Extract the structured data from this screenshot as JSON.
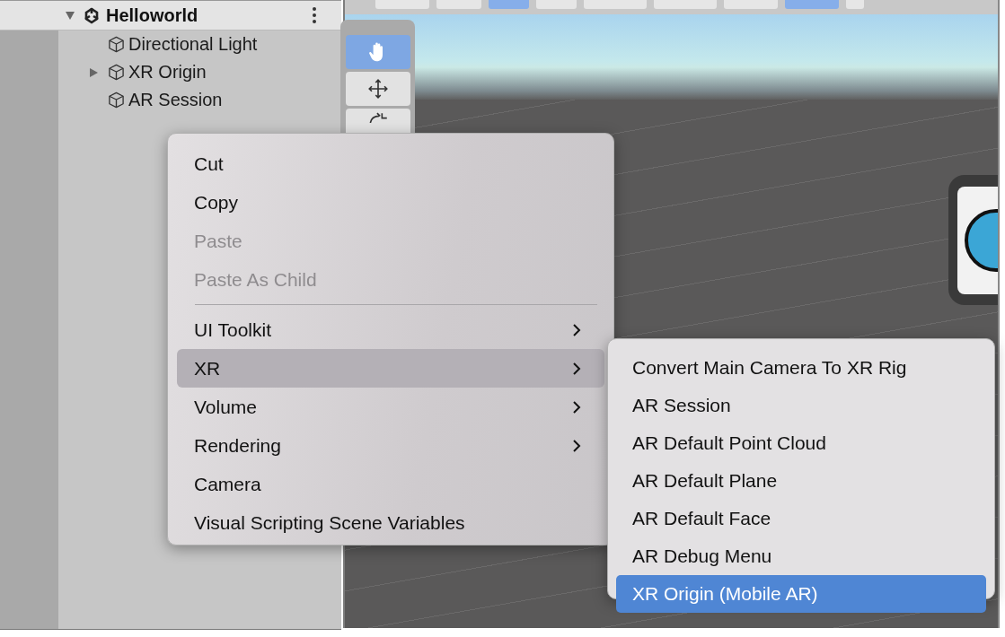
{
  "hierarchy": {
    "scene": {
      "label": "Helloworld",
      "expanded": true,
      "children": [
        {
          "label": "Directional Light"
        },
        {
          "label": "XR Origin",
          "expanded": false
        },
        {
          "label": "AR Session"
        }
      ]
    }
  },
  "scene_tools": [
    {
      "kind": "hand",
      "selected": true
    },
    {
      "kind": "move",
      "selected": false
    },
    {
      "kind": "rotate",
      "selected": false
    }
  ],
  "context_menu": {
    "items": [
      {
        "kind": "item",
        "label": "Cut",
        "disabled": false,
        "has_submenu": false,
        "highlighted": false
      },
      {
        "kind": "item",
        "label": "Copy",
        "disabled": false,
        "has_submenu": false,
        "highlighted": false
      },
      {
        "kind": "item",
        "label": "Paste",
        "disabled": true,
        "has_submenu": false,
        "highlighted": false
      },
      {
        "kind": "item",
        "label": "Paste As Child",
        "disabled": true,
        "has_submenu": false,
        "highlighted": false
      },
      {
        "kind": "separator"
      },
      {
        "kind": "item",
        "label": "UI Toolkit",
        "disabled": false,
        "has_submenu": true,
        "highlighted": false
      },
      {
        "kind": "item",
        "label": "XR",
        "disabled": false,
        "has_submenu": true,
        "highlighted": true
      },
      {
        "kind": "item",
        "label": "Volume",
        "disabled": false,
        "has_submenu": true,
        "highlighted": false
      },
      {
        "kind": "item",
        "label": "Rendering",
        "disabled": false,
        "has_submenu": true,
        "highlighted": false
      },
      {
        "kind": "item",
        "label": "Camera",
        "disabled": false,
        "has_submenu": false,
        "highlighted": false
      },
      {
        "kind": "item",
        "label": "Visual Scripting Scene Variables",
        "disabled": false,
        "has_submenu": false,
        "highlighted": false
      }
    ]
  },
  "submenu": {
    "items": [
      {
        "label": "Convert Main Camera To XR Rig",
        "selected": false
      },
      {
        "label": "AR Session",
        "selected": false
      },
      {
        "label": "AR Default Point Cloud",
        "selected": false
      },
      {
        "label": "AR Default Plane",
        "selected": false
      },
      {
        "label": "AR Default Face",
        "selected": false
      },
      {
        "label": "AR Debug Menu",
        "selected": false
      },
      {
        "label": "XR Origin (Mobile AR)",
        "selected": true
      }
    ]
  }
}
